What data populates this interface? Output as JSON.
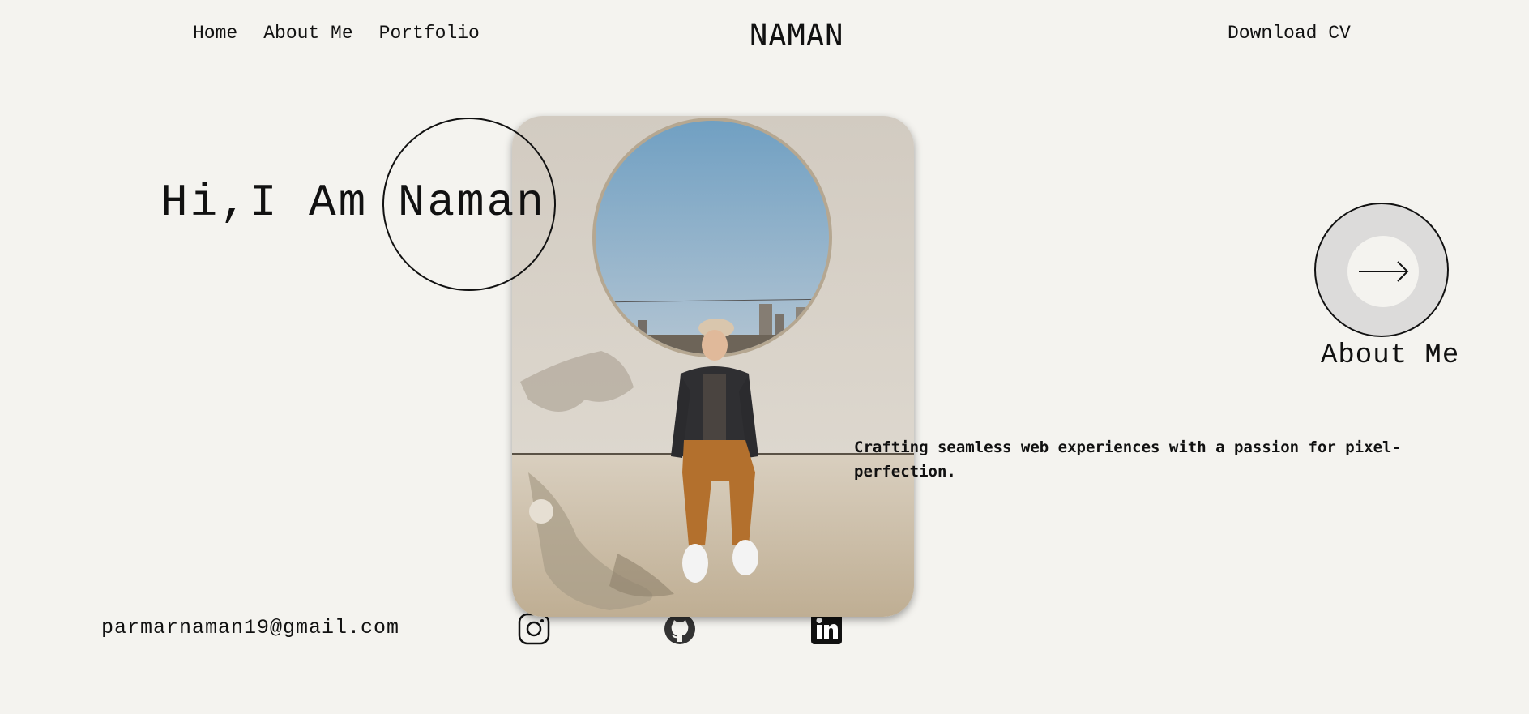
{
  "nav": {
    "links": [
      "Home",
      "About Me",
      "Portfolio"
    ],
    "brand": "NAMAN",
    "download_label": "Download CV"
  },
  "hero": {
    "title": "Hi,I Am Naman",
    "tagline": "Crafting seamless web experiences with a passion for pixel-perfection."
  },
  "about_button": {
    "label": "About Me",
    "icon": "arrow-right-icon"
  },
  "footer": {
    "email": "parmarnaman19@gmail.com",
    "socials": [
      "instagram-icon",
      "github-icon",
      "linkedin-icon"
    ]
  },
  "colors": {
    "background": "#f4f3ef",
    "text": "#111111",
    "button_fill": "#dcdbda"
  }
}
